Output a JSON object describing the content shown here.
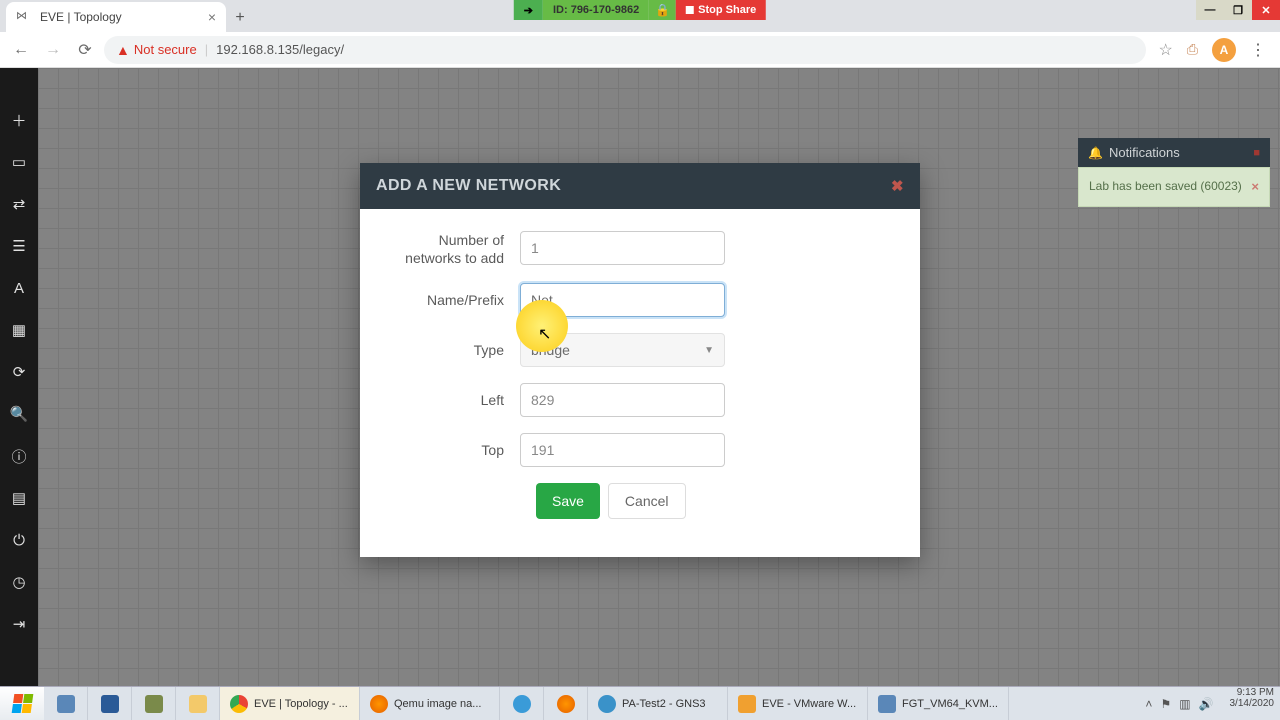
{
  "zoom_bar": {
    "id_label": "ID: 796-170-9862",
    "stop_share": "Stop Share"
  },
  "browser": {
    "tab_title": "EVE | Topology",
    "not_secure": "Not secure",
    "url": "192.168.8.135/legacy/",
    "avatar_letter": "A"
  },
  "modal": {
    "title": "ADD A NEW NETWORK",
    "labels": {
      "count": "Number of networks to add",
      "name": "Name/Prefix",
      "type": "Type",
      "left": "Left",
      "top": "Top"
    },
    "values": {
      "count": "1",
      "name": "Net",
      "type": "bridge",
      "left": "829",
      "top": "191"
    },
    "buttons": {
      "save": "Save",
      "cancel": "Cancel"
    }
  },
  "notifications": {
    "header": "Notifications",
    "item": "Lab has been saved (60023)"
  },
  "taskbar": {
    "items": [
      "EVE | Topology - ...",
      "Qemu image na...",
      "PA-Test2 - GNS3",
      "EVE - VMware W...",
      "FGT_VM64_KVM..."
    ],
    "time": "9:13 PM",
    "date": "3/14/2020"
  }
}
